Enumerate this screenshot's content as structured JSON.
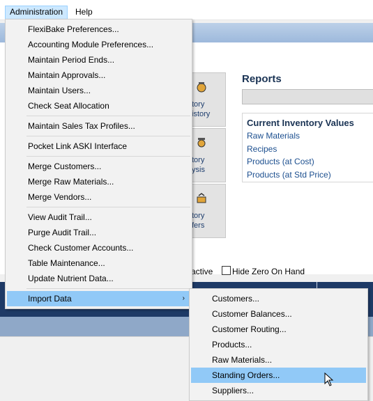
{
  "menubar": {
    "items": [
      "Administration",
      "Help"
    ]
  },
  "tiles": [
    {
      "line1": "tory",
      "line2": "istory"
    },
    {
      "line1": "tory",
      "line2": "ysis"
    },
    {
      "line1": "tory",
      "line2": "fers"
    }
  ],
  "reports": {
    "title": "Reports",
    "section_title": "Current Inventory Values",
    "links": [
      "Raw Materials",
      "Recipes",
      "Products (at Cost)",
      "Products (at Std Price)"
    ]
  },
  "filters": {
    "active_partial": "active",
    "hide_zero_label": "Hide Zero On Hand"
  },
  "admin_menu": {
    "groups": [
      [
        "FlexiBake Preferences...",
        "Accounting Module Preferences...",
        "Maintain Period Ends...",
        "Maintain Approvals...",
        "Maintain Users...",
        "Check Seat Allocation"
      ],
      [
        "Maintain Sales Tax Profiles..."
      ],
      [
        "Pocket Link ASKI Interface"
      ],
      [
        "Merge Customers...",
        "Merge Raw Materials...",
        "Merge Vendors..."
      ],
      [
        "View Audit Trail...",
        "Purge Audit Trail...",
        "Check Customer Accounts...",
        "Table Maintenance...",
        "Update Nutrient Data..."
      ],
      [
        "Import Data"
      ]
    ],
    "submenu_arrow": "›"
  },
  "import_submenu": {
    "items": [
      "Customers...",
      "Customer Balances...",
      "Customer Routing...",
      "Products...",
      "Raw Materials...",
      "Standing Orders...",
      "Suppliers..."
    ],
    "highlighted_index": 5
  },
  "colors": {
    "highlight": "#91c9f7",
    "header_blue": "#1e3a66",
    "link_blue": "#1c4f8f"
  }
}
